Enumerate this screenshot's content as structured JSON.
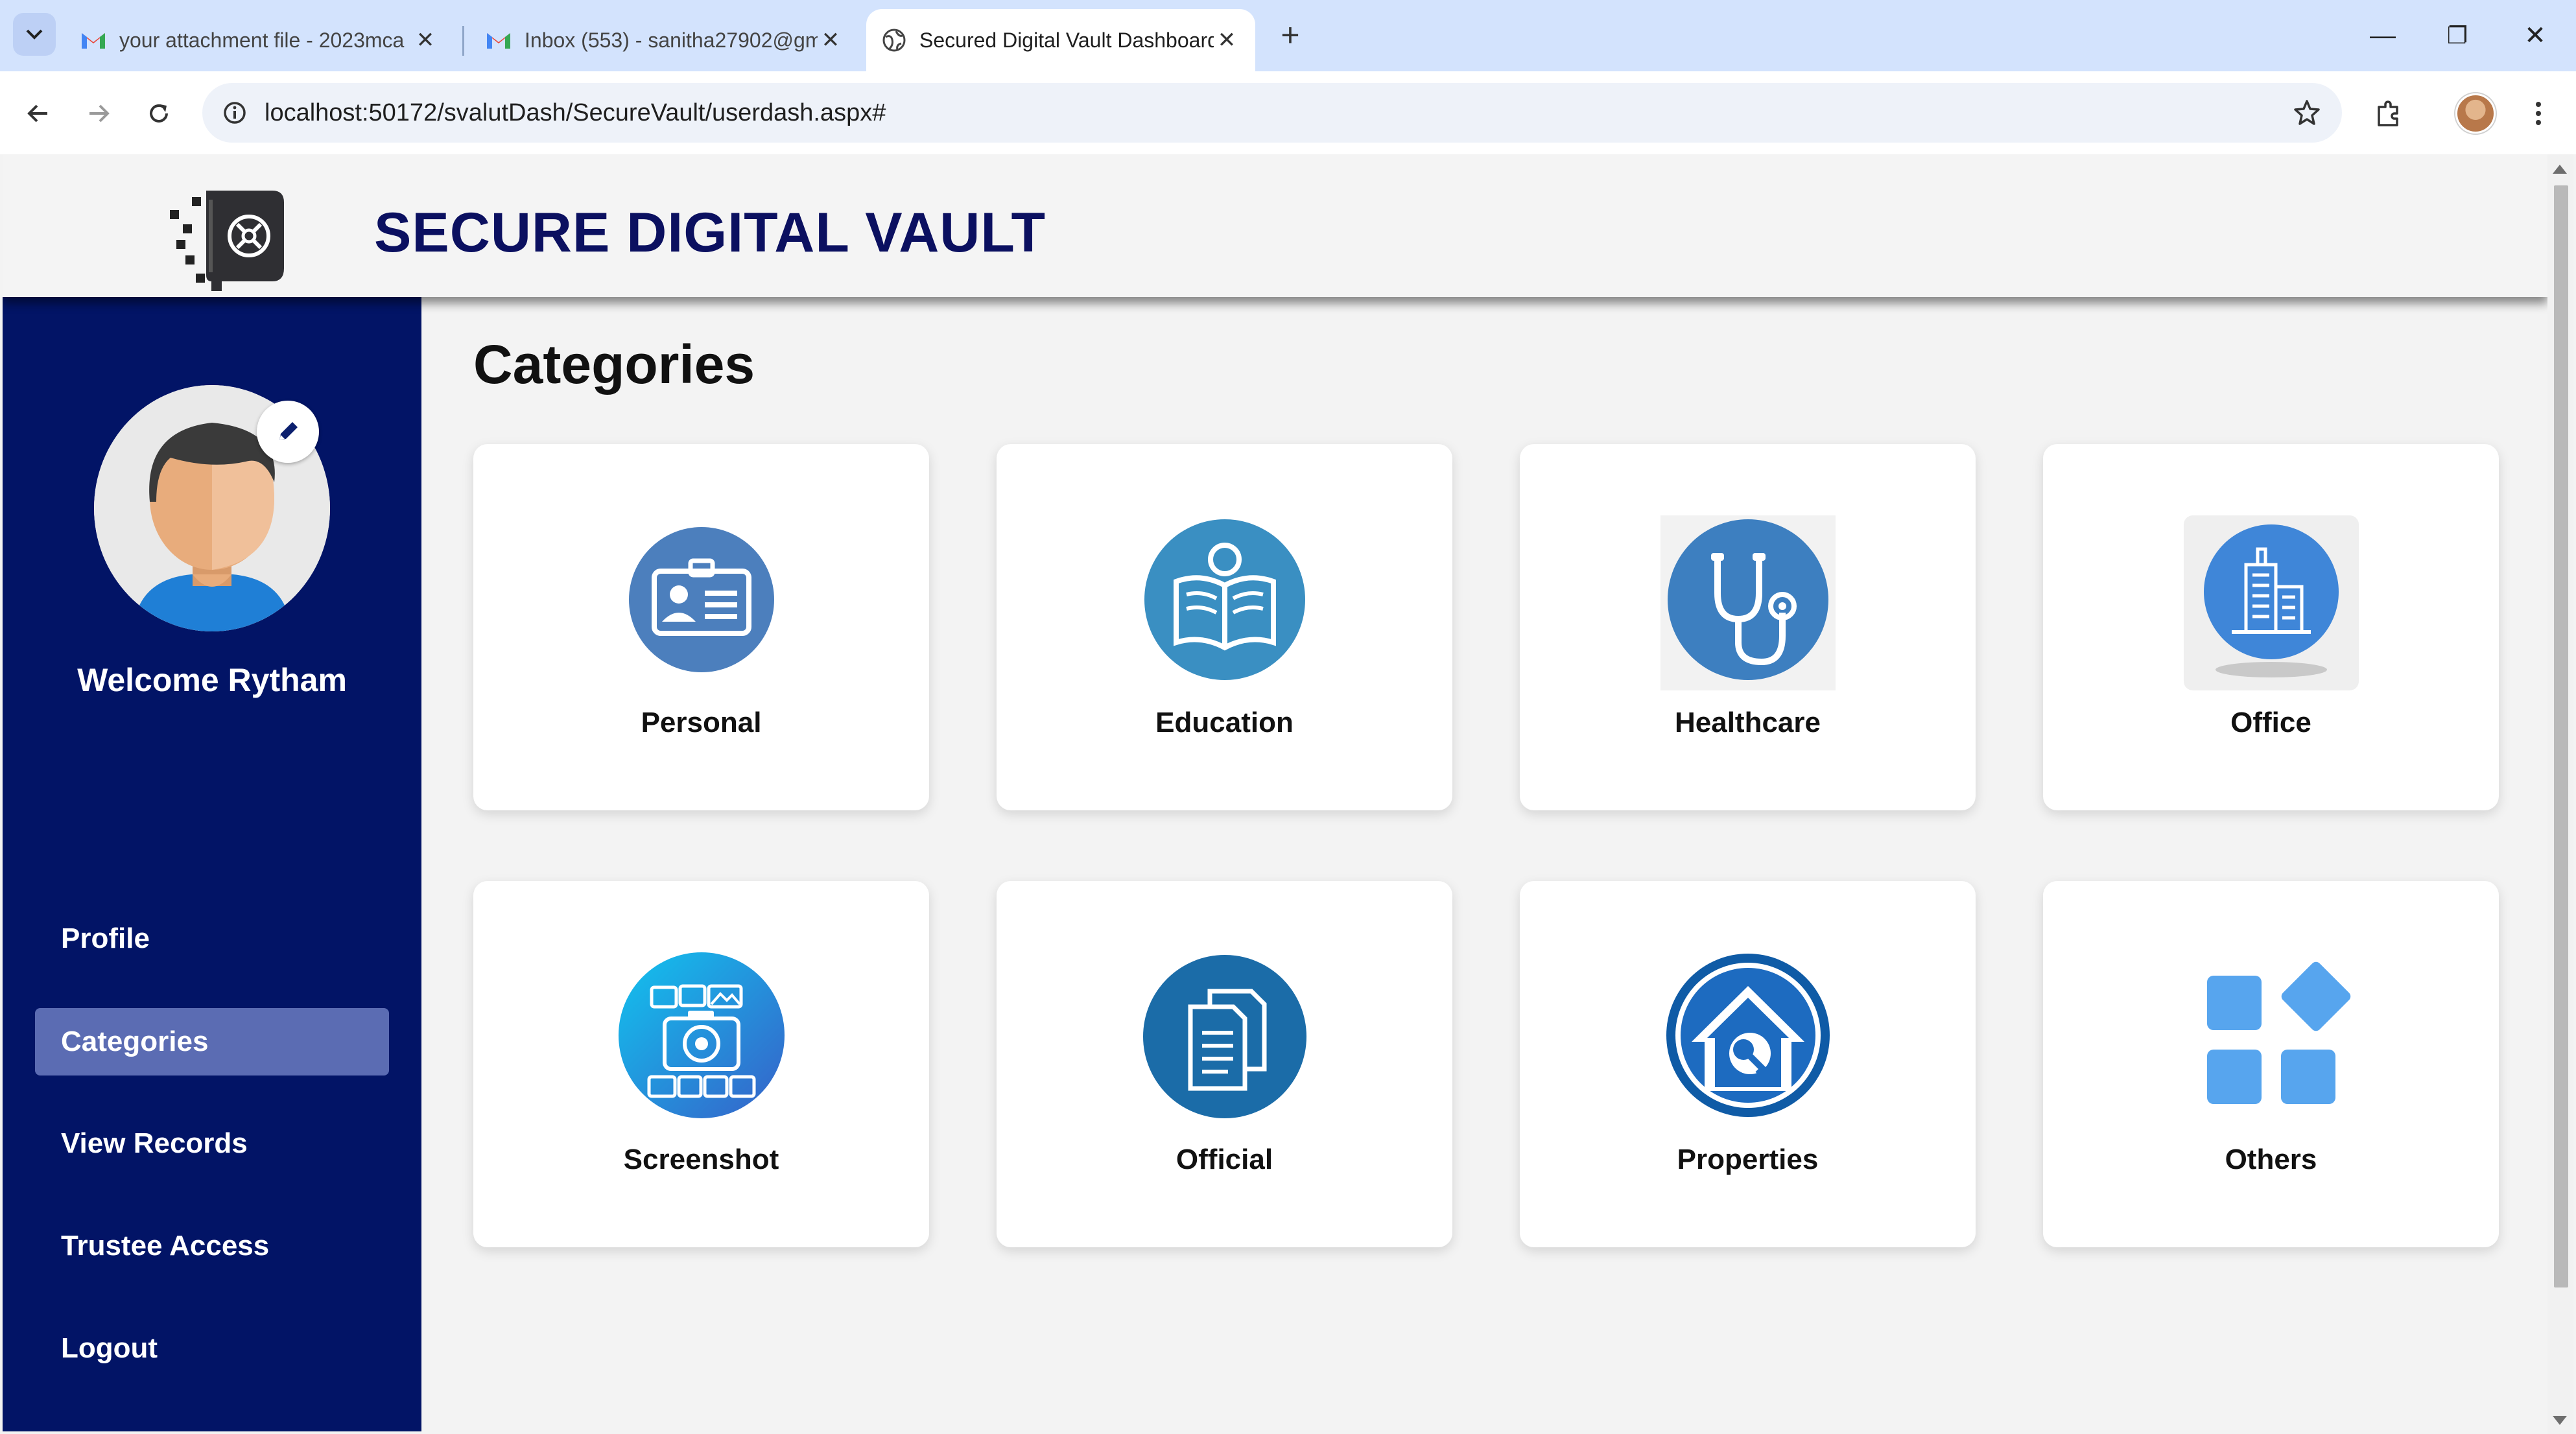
{
  "browser": {
    "tabs": [
      {
        "title": "your attachment file - 2023mca",
        "close": "✕",
        "icon": "gmail-icon"
      },
      {
        "title": "Inbox (553) - sanitha27902@gm",
        "close": "✕",
        "icon": "gmail-icon"
      },
      {
        "title": "Secured Digital Vault Dashboard",
        "close": "✕",
        "icon": "globe-icon"
      }
    ],
    "new_tab": "+",
    "window": {
      "minimize": "—",
      "restore": "❐",
      "close": "✕"
    },
    "url": "localhost:50172/svalutDash/SecureVault/userdash.aspx#"
  },
  "header": {
    "title": "SECURE DIGITAL VAULT",
    "logo_icon": "vault-safe-icon"
  },
  "sidebar": {
    "welcome": "Welcome Rytham",
    "items": [
      {
        "label": "Profile",
        "active": false
      },
      {
        "label": "Categories",
        "active": true
      },
      {
        "label": "View Records",
        "active": false
      },
      {
        "label": "Trustee Access",
        "active": false
      },
      {
        "label": "Logout",
        "active": false
      }
    ]
  },
  "main": {
    "heading": "Categories",
    "categories": [
      {
        "label": "Personal",
        "icon": "id-card-icon"
      },
      {
        "label": "Education",
        "icon": "open-book-icon"
      },
      {
        "label": "Healthcare",
        "icon": "stethoscope-icon"
      },
      {
        "label": "Office",
        "icon": "office-building-icon"
      },
      {
        "label": "Screenshot",
        "icon": "camera-collage-icon"
      },
      {
        "label": "Official",
        "icon": "documents-icon"
      },
      {
        "label": "Properties",
        "icon": "house-key-icon"
      },
      {
        "label": "Others",
        "icon": "app-grid-icon"
      }
    ]
  },
  "colors": {
    "sidebar_bg": "#021466",
    "sidebar_active": "#5b6cb3",
    "title": "#0b1060",
    "tab_strip": "#d3e3fd"
  }
}
